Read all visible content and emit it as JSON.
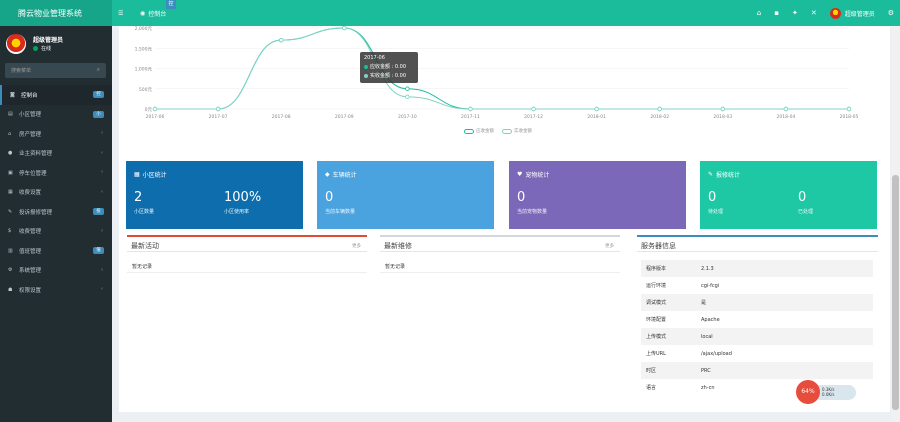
{
  "topbar": {
    "brand": "腾云物业管理系统",
    "tab1": "首页",
    "tab2": "控制台",
    "badge": "控",
    "user": "超级管理员",
    "icons": [
      "home-icon",
      "trash-icon",
      "lock-icon",
      "expand-icon",
      "user-avatar",
      "gear-icon"
    ]
  },
  "sidebar": {
    "profile_name": "超级管理员",
    "status": "在线",
    "search_placeholder": "搜索菜单",
    "items": [
      {
        "label": "控制台",
        "badge": "控",
        "active": true
      },
      {
        "label": "小区管理",
        "badge": "小"
      },
      {
        "label": "房产管理",
        "chevron": "‹"
      },
      {
        "label": "业主资料管理",
        "chevron": "‹"
      },
      {
        "label": "停车位管理",
        "chevron": "‹"
      },
      {
        "label": "收费设置",
        "chevron": "‹"
      },
      {
        "label": "投诉报修管理",
        "badge": "投"
      },
      {
        "label": "收费管理",
        "chevron": "‹"
      },
      {
        "label": "值班管理",
        "badge": "值"
      },
      {
        "label": "系统管理",
        "chevron": "‹"
      },
      {
        "label": "权限设置",
        "chevron": "‹"
      }
    ]
  },
  "chart_data": {
    "type": "line",
    "x": [
      "2017-06",
      "2017-07",
      "2017-08",
      "2017-09",
      "2017-10",
      "2017-11",
      "2017-12",
      "2018-01",
      "2018-02",
      "2018-03",
      "2018-04",
      "2018-05"
    ],
    "yticks": [
      "0元",
      "500元",
      "1,000元",
      "1,500元",
      "2,000元"
    ],
    "ylim": [
      0,
      2000
    ],
    "series": [
      {
        "name": "应收金额",
        "values": [
          0,
          0,
          1700,
          2000,
          500,
          0,
          0,
          0,
          0,
          0,
          0,
          0
        ]
      },
      {
        "name": "实收金额",
        "values": [
          0,
          0,
          1700,
          2000,
          300,
          0,
          0,
          0,
          0,
          0,
          0,
          0
        ]
      }
    ],
    "tooltip": {
      "title": "2017-06",
      "rows": [
        "应收金额 : 0.00",
        "实收金额 : 0.00"
      ]
    },
    "colors": {
      "line": "#1abc9c",
      "line2": "#7fd3c3",
      "grid": "#eeeeee"
    }
  },
  "stats": [
    {
      "title": "小区统计",
      "icon": "building-icon",
      "color": "#0e6ead",
      "values": [
        {
          "v": "2",
          "l": "小区数量"
        },
        {
          "v": "100%",
          "l": "小区使用率"
        }
      ]
    },
    {
      "title": "车辆统计",
      "icon": "car-icon",
      "color": "#4aa3df",
      "values": [
        {
          "v": "0",
          "l": "当前车辆数量"
        }
      ]
    },
    {
      "title": "宠物统计",
      "icon": "heart-icon",
      "color": "#7b68b8",
      "values": [
        {
          "v": "0",
          "l": "当前宠物数量"
        }
      ]
    },
    {
      "title": "报修统计",
      "icon": "wrench-icon",
      "color": "#1fc8a5",
      "values": [
        {
          "v": "0",
          "l": "待处理"
        },
        {
          "v": "0",
          "l": "已处理"
        }
      ]
    }
  ],
  "panels": {
    "activity": {
      "title": "最新活动",
      "more": "更多",
      "empty": "暂无记录"
    },
    "repair": {
      "title": "最新维修",
      "more": "更多",
      "empty": "暂无记录"
    },
    "server": {
      "title": "服务器信息",
      "rows": [
        {
          "k": "程序版本",
          "v": "2.1.3"
        },
        {
          "k": "运行环境",
          "v": "cgi-fcgi"
        },
        {
          "k": "调试模式",
          "v": "是"
        },
        {
          "k": "环境配置",
          "v": "Apache"
        },
        {
          "k": "上传模式",
          "v": "local"
        },
        {
          "k": "上传URL",
          "v": "/ajax/upload"
        },
        {
          "k": "时区",
          "v": "PRC"
        },
        {
          "k": "语言",
          "v": "zh-cn"
        }
      ]
    }
  },
  "widget": {
    "percent": "64%",
    "line1": "0.3K/s",
    "line2": "0.0K/s"
  }
}
